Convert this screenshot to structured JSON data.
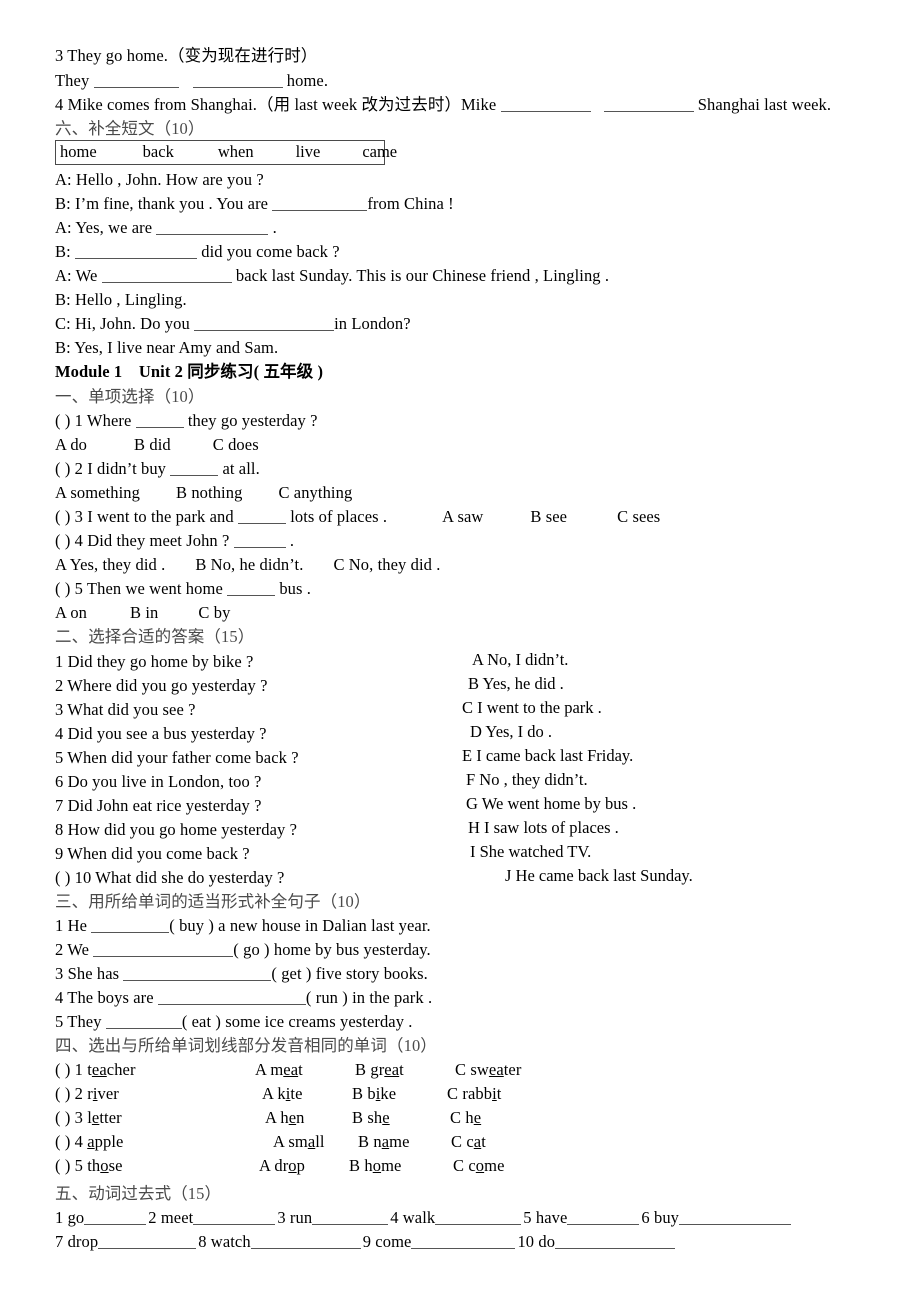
{
  "document": {
    "type": "chinese-english-worksheet",
    "title_line": "Module 1　Unit 2  同步练习(  五年级  )"
  },
  "top_section": {
    "q3": {
      "prompt": "3 They go home.（变为现在进行时）",
      "answer_line_pre": "They ",
      "answer_line_mid": "",
      "answer_line_post": " home."
    },
    "q4": {
      "prompt": "4 Mike comes from Shanghai.（用 last week 改为过去时）Mike ",
      "post": " Shanghai last week."
    }
  },
  "section6": {
    "heading": "六、补全短文（10）",
    "word_bank": [
      "home",
      "back",
      "when",
      "live",
      "came"
    ],
    "dialogue": [
      {
        "pre": "A: Hello , John. How are you ?",
        "blank": 0,
        "post": ""
      },
      {
        "pre": "B: I’m fine, thank you . You are ",
        "blank": 95,
        "post": "from China !"
      },
      {
        "pre": "A: Yes, we are ",
        "blank": 112,
        "post": " ."
      },
      {
        "pre": "B: ",
        "blank": 122,
        "post": " did you come back ?"
      },
      {
        "pre": "A: We ",
        "blank": 130,
        "post": " back last Sunday. This is our Chinese friend , Lingling ."
      },
      {
        "pre": "B: Hello , Lingling.",
        "blank": 0,
        "post": ""
      },
      {
        "pre": "C: Hi, John. Do you ",
        "blank": 140,
        "post": "in London?"
      },
      {
        "pre": "B: Yes, I live near Amy and Sam.",
        "blank": 0,
        "post": ""
      }
    ]
  },
  "section1": {
    "heading": "一、单项选择（10）",
    "questions": [
      {
        "stem_pre": "(    ) 1 Where ",
        "blank": 48,
        "stem_post": " they go yesterday ?",
        "options_inline": false,
        "options": [
          "A do",
          "B did",
          "C does"
        ]
      },
      {
        "stem_pre": "(    ) 2 I didn’t buy ",
        "blank": 48,
        "stem_post": " at all.",
        "options_inline": false,
        "options": [
          "A something",
          "B nothing",
          "C anything"
        ]
      },
      {
        "stem_pre": "(    ) 3 I went to the park and ",
        "blank": 48,
        "stem_post": " lots of places .",
        "options_inline": true,
        "options": [
          "A saw",
          "B see",
          "C sees"
        ]
      },
      {
        "stem_pre": "(    ) 4 Did they meet John ? ",
        "blank": 52,
        "stem_post": " .",
        "options_inline": false,
        "options": [
          "A Yes, they did .",
          "B No, he didn’t.",
          "C No, they did ."
        ]
      },
      {
        "stem_pre": "(    ) 5 Then we went home ",
        "blank": 48,
        "stem_post": " bus .",
        "options_inline": false,
        "options": [
          "A on",
          "B in",
          "C by"
        ]
      }
    ]
  },
  "section2": {
    "heading": "二、选择合适的答案（15）",
    "left_items": [
      "1 Did they go home by bike ?",
      "2 Where did you go yesterday ?",
      "3 What did you see ?",
      "4 Did you see a bus yesterday ?",
      "5 When did your father come back ?",
      "6 Do you live in London, too ?",
      "7 Did John eat rice yesterday ?",
      "8 How did you go home yesterday ?",
      "9 When did you come back ?",
      "(    ) 10 What did she do yesterday ?"
    ],
    "right_items": [
      "A No, I didn’t.",
      "B Yes, he did .",
      "C I went to the park .",
      "D Yes, I do .",
      "E I came back last Friday.",
      "F No , they didn’t.",
      "G We went home by bus .",
      "H I saw lots of places .",
      "I She watched TV.",
      "J He came back last Sunday."
    ],
    "right_offsets": [
      472,
      468,
      462,
      470,
      462,
      466,
      466,
      468,
      470,
      505
    ]
  },
  "section3": {
    "heading": "三、用所给单词的适当形式补全句子（10）",
    "items": [
      {
        "pre": "1 He ",
        "blank": 78,
        "post": "( buy ) a new house in Dalian last year."
      },
      {
        "pre": "2 We ",
        "blank": 140,
        "post": "( go ) home by bus yesterday."
      },
      {
        "pre": "3 She has ",
        "blank": 148,
        "post": "( get ) five story books."
      },
      {
        "pre": "4 The boys are ",
        "blank": 148,
        "post": "( run ) in the park ."
      },
      {
        "pre": "5 They ",
        "blank": 76,
        "post": "( eat ) some ice creams yesterday ."
      }
    ]
  },
  "section4": {
    "heading": "四、选出与所给单词划线部分发音相同的单词（10）",
    "rows": [
      {
        "num": "(    ) 1 ",
        "word": [
          [
            "t",
            0
          ],
          [
            "ea",
            1
          ],
          [
            "cher",
            0
          ]
        ],
        "options": [
          {
            "letter": "A ",
            "parts": [
              [
                "m",
                0
              ],
              [
                "ea",
                1
              ],
              [
                "t",
                0
              ]
            ]
          },
          {
            "letter": "B ",
            "parts": [
              [
                "gr",
                0
              ],
              [
                "ea",
                1
              ],
              [
                "t",
                0
              ]
            ]
          },
          {
            "letter": "C ",
            "parts": [
              [
                "sw",
                0
              ],
              [
                "ea",
                1
              ],
              [
                "ter",
                0
              ]
            ]
          }
        ],
        "opt_x": [
          200,
          300,
          400
        ]
      },
      {
        "num": "(    ) 2 ",
        "word": [
          [
            "r",
            0
          ],
          [
            "i",
            1
          ],
          [
            "ver",
            0
          ]
        ],
        "options": [
          {
            "letter": "A ",
            "parts": [
              [
                "k",
                0
              ],
              [
                "i",
                1
              ],
              [
                "te",
                0
              ]
            ]
          },
          {
            "letter": "B ",
            "parts": [
              [
                "b",
                0
              ],
              [
                "i",
                1
              ],
              [
                "ke",
                0
              ]
            ]
          },
          {
            "letter": "C ",
            "parts": [
              [
                "rabb",
                0
              ],
              [
                "i",
                1
              ],
              [
                "t",
                0
              ]
            ]
          }
        ],
        "opt_x": [
          207,
          297,
          392
        ]
      },
      {
        "num": "(    ) 3 ",
        "word": [
          [
            "l",
            0
          ],
          [
            "e",
            1
          ],
          [
            "tter",
            0
          ]
        ],
        "options": [
          {
            "letter": "A ",
            "parts": [
              [
                "h",
                0
              ],
              [
                "e",
                1
              ],
              [
                "n",
                0
              ]
            ]
          },
          {
            "letter": "B ",
            "parts": [
              [
                "sh",
                0
              ],
              [
                "e",
                1
              ]
            ]
          },
          {
            "letter": "C ",
            "parts": [
              [
                "h",
                0
              ],
              [
                "e",
                1
              ]
            ]
          }
        ],
        "opt_x": [
          210,
          297,
          395
        ]
      },
      {
        "num": "(    ) 4 ",
        "word": [
          [
            "a",
            1
          ],
          [
            "pple",
            0
          ]
        ],
        "options": [
          {
            "letter": "A ",
            "parts": [
              [
                "sm",
                0
              ],
              [
                "a",
                1
              ],
              [
                "ll",
                0
              ]
            ]
          },
          {
            "letter": "B ",
            "parts": [
              [
                "n",
                0
              ],
              [
                "a",
                1
              ],
              [
                "me",
                0
              ]
            ]
          },
          {
            "letter": "C ",
            "parts": [
              [
                "c",
                0
              ],
              [
                "a",
                1
              ],
              [
                "t",
                0
              ]
            ]
          }
        ],
        "opt_x": [
          218,
          303,
          396
        ]
      },
      {
        "num": "(    ) 5 ",
        "word": [
          [
            "th",
            0
          ],
          [
            "o",
            1
          ],
          [
            "se",
            0
          ]
        ],
        "options": [
          {
            "letter": "A ",
            "parts": [
              [
                "dr",
                0
              ],
              [
                "o",
                1
              ],
              [
                "p",
                0
              ]
            ]
          },
          {
            "letter": "B ",
            "parts": [
              [
                "h",
                0
              ],
              [
                "o",
                1
              ],
              [
                "me",
                0
              ]
            ]
          },
          {
            "letter": "C ",
            "parts": [
              [
                "c",
                0
              ],
              [
                "o",
                1
              ],
              [
                "me",
                0
              ]
            ]
          }
        ],
        "opt_x": [
          204,
          294,
          398
        ]
      }
    ]
  },
  "section5": {
    "heading": "五、动词过去式（15）",
    "row1": [
      {
        "label": "1 go",
        "blank": 62
      },
      {
        "label": "2 meet",
        "blank": 82
      },
      {
        "label": "3 run",
        "blank": 76
      },
      {
        "label": "4 walk",
        "blank": 86
      },
      {
        "label": "5 have",
        "blank": 72
      },
      {
        "label": "6 buy",
        "blank": 112
      }
    ],
    "row2": [
      {
        "label": "7 drop",
        "blank": 98
      },
      {
        "label": "8 watch",
        "blank": 110
      },
      {
        "label": "9 come",
        "blank": 104
      },
      {
        "label": "10 do",
        "blank": 120
      }
    ]
  },
  "colors": {
    "text": "#000000",
    "heading_cn": "#4a4a4a",
    "rule": "#555555",
    "background": "#ffffff"
  }
}
